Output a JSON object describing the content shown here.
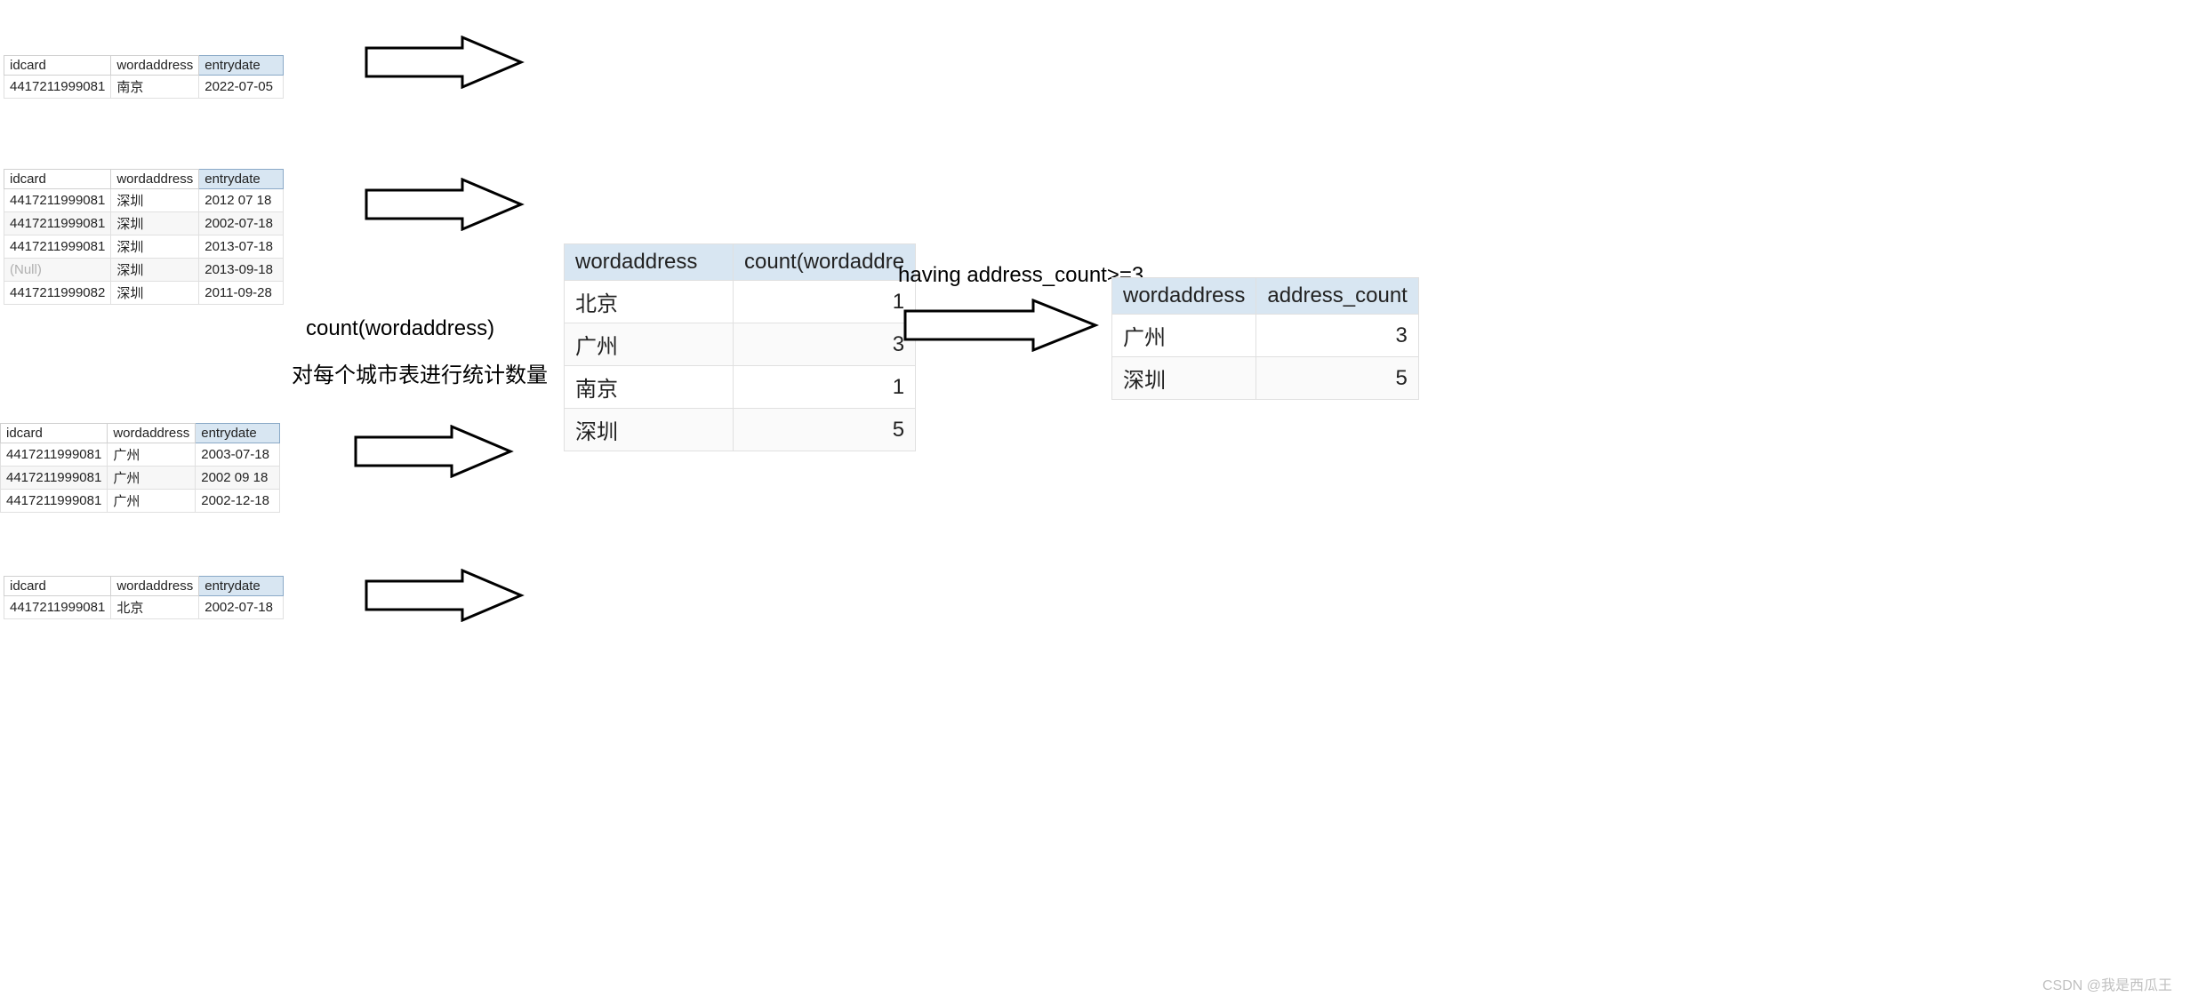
{
  "headers": {
    "idcard": "idcard",
    "wordaddress": "wordaddress",
    "entrydate": "entrydate",
    "count_col": "count(wordaddre",
    "addr_count": "address_count"
  },
  "tables": {
    "nanjing": [
      {
        "idcard": "4417211999081",
        "addr": "南京",
        "date": "2022-07-05"
      }
    ],
    "shenzhen": [
      {
        "idcard": "4417211999081",
        "addr": "深圳",
        "date": "2012 07 18"
      },
      {
        "idcard": "4417211999081",
        "addr": "深圳",
        "date": "2002-07-18"
      },
      {
        "idcard": "4417211999081",
        "addr": "深圳",
        "date": "2013-07-18"
      },
      {
        "idcard": "(Null)",
        "addr": "深圳",
        "date": "2013-09-18",
        "null": true
      },
      {
        "idcard": "4417211999082",
        "addr": "深圳",
        "date": "2011-09-28"
      }
    ],
    "guangzhou": [
      {
        "idcard": "4417211999081",
        "addr": "广州",
        "date": "2003-07-18"
      },
      {
        "idcard": "4417211999081",
        "addr": "广州",
        "date": "2002 09 18"
      },
      {
        "idcard": "4417211999081",
        "addr": "广州",
        "date": "2002-12-18"
      }
    ],
    "beijing": [
      {
        "idcard": "4417211999081",
        "addr": "北京",
        "date": "2002-07-18"
      }
    ]
  },
  "labels": {
    "count_label": "count(wordaddress)",
    "desc": "对每个城市表进行统计数量",
    "having": "having address_count>=3"
  },
  "count_result": [
    {
      "addr": "北京",
      "cnt": "1"
    },
    {
      "addr": "广州",
      "cnt": "3"
    },
    {
      "addr": "南京",
      "cnt": "1"
    },
    {
      "addr": "深圳",
      "cnt": "5"
    }
  ],
  "having_result": [
    {
      "addr": "广州",
      "cnt": "3"
    },
    {
      "addr": "深圳",
      "cnt": "5"
    }
  ],
  "watermark": "CSDN @我是西瓜王"
}
